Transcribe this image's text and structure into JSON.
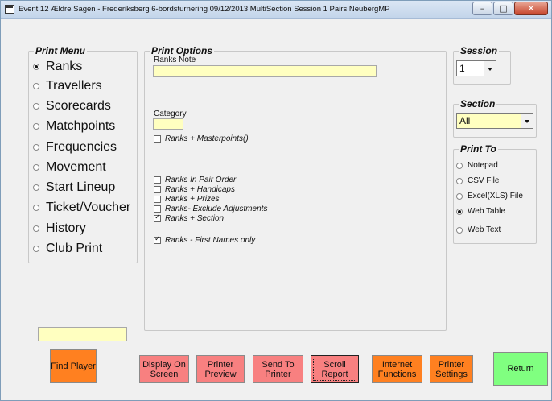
{
  "window": {
    "title": "Event 12  Ældre Sagen - Frederiksberg 6-bordsturnering 09/12/2013 MultiSection Session 1 Pairs NeubergMP",
    "minimize": "–",
    "maximize": "□",
    "close": "✕"
  },
  "print_menu": {
    "title": "Print Menu",
    "items": [
      {
        "label": "Ranks",
        "selected": true
      },
      {
        "label": "Travellers",
        "selected": false
      },
      {
        "label": "Scorecards",
        "selected": false
      },
      {
        "label": "Matchpoints",
        "selected": false
      },
      {
        "label": "Frequencies",
        "selected": false
      },
      {
        "label": "Movement",
        "selected": false
      },
      {
        "label": "Start Lineup",
        "selected": false
      },
      {
        "label": "Ticket/Voucher",
        "selected": false
      },
      {
        "label": "History",
        "selected": false
      },
      {
        "label": "Club Print",
        "selected": false
      }
    ]
  },
  "print_options": {
    "title": "Print Options",
    "ranks_note_label": "Ranks Note",
    "ranks_note_value": "",
    "category_label": "Category",
    "category_value": "",
    "checks": [
      {
        "label": "Ranks + Masterpoints()",
        "checked": false
      },
      {
        "label": "Ranks In Pair Order",
        "checked": false
      },
      {
        "label": "Ranks + Handicaps",
        "checked": false
      },
      {
        "label": "Ranks + Prizes",
        "checked": false
      },
      {
        "label": "Ranks- Exclude Adjustments",
        "checked": false
      },
      {
        "label": "Ranks + Section",
        "checked": true
      },
      {
        "label": "Ranks - First Names only",
        "checked": true
      }
    ]
  },
  "session": {
    "title": "Session",
    "value": "1"
  },
  "section": {
    "title": "Section",
    "value": "All"
  },
  "print_to": {
    "title": "Print To",
    "items": [
      {
        "label": "Notepad",
        "selected": false
      },
      {
        "label": "CSV File",
        "selected": false
      },
      {
        "label": "Excel(XLS) File",
        "selected": false
      },
      {
        "label": "Web Table",
        "selected": true
      },
      {
        "label": "Web Text",
        "selected": false
      }
    ]
  },
  "find_player_input": "",
  "buttons": {
    "find_player": "Find Player",
    "display_on_screen_1": "Display On",
    "display_on_screen_2": "Screen",
    "printer_preview_1": "Printer",
    "printer_preview_2": "Preview",
    "send_to_printer_1": "Send To",
    "send_to_printer_2": "Printer",
    "scroll_report_1": "Scroll",
    "scroll_report_2": "Report",
    "internet_functions_1": "Internet",
    "internet_functions_2": "Functions",
    "printer_settings_1": "Printer",
    "printer_settings_2": "Settings",
    "return": "Return"
  },
  "colors": {
    "orange": "#ff8020",
    "pink": "#f88080",
    "green": "#80ff80",
    "input_yellow": "#ffffc0"
  }
}
